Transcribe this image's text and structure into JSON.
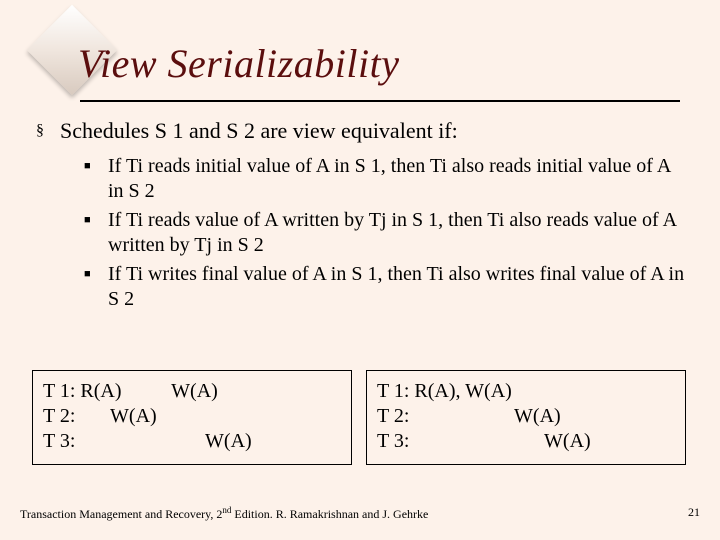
{
  "title": "View Serializability",
  "main_bullet": "Schedules S 1 and S 2 are view equivalent if:",
  "sub_bullets": [
    "If Ti reads initial value of A in S 1, then Ti also reads initial value of A in S 2",
    "If Ti reads value of A written by Tj in S 1, then Ti also reads value of A written by Tj in S 2",
    "If Ti writes final value of A in S 1, then Ti also writes final value of A in S 2"
  ],
  "box1": {
    "t1": "T 1: R(A)          W(A)",
    "t2": "T 2:       W(A)",
    "t3": "T 3:                          W(A)"
  },
  "box2": {
    "t1": "T 1: R(A), W(A)",
    "t2": "T 2:                     W(A)",
    "t3": "T 3:                           W(A)"
  },
  "footer_left_a": "Transaction Management and Recovery, 2",
  "footer_left_sup": "nd",
  "footer_left_b": " Edition. R. Ramakrishnan and J. Gehrke",
  "page_number": "21"
}
